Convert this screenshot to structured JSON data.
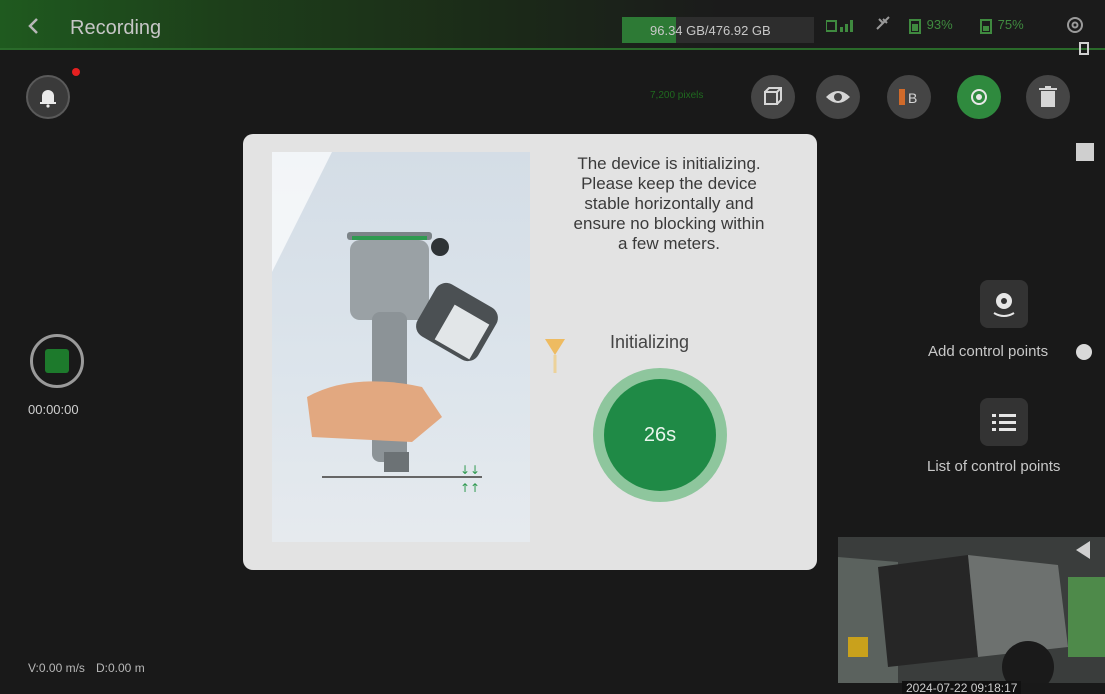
{
  "header": {
    "back_icon": "chevron-left-icon",
    "title": "Recording",
    "storage": "96.34 GB/476.92 GB",
    "status_icons": [
      "signal-icon",
      "satellite-icon",
      "battery-icon",
      "battery-icon"
    ],
    "battery_1": "93%",
    "battery_2": "75%",
    "settings_icon": "gear-icon"
  },
  "toolbar": {
    "pixels_label": "7,200 pixels",
    "buttons": [
      "cube-icon",
      "eye-icon",
      "color-mode-icon",
      "locate-icon",
      "trash-icon"
    ]
  },
  "recording": {
    "timer": "00:00:00",
    "speed": "V:0.00 m/s",
    "distance": "D:0.00 m"
  },
  "control_points": {
    "add_label": "Add control points",
    "list_label": "List of control points"
  },
  "preview": {
    "timestamp": "2024-07-22 09:18:17"
  },
  "dialog": {
    "message": "The device is initializing.\nPlease keep the device\nstable horizontally and\nensure no blocking within\na few meters.",
    "status": "Initializing",
    "countdown": "26s"
  },
  "colors": {
    "accent_green": "#1f8a46",
    "ring_green": "#8ec69d",
    "alert_red": "#e52020"
  }
}
